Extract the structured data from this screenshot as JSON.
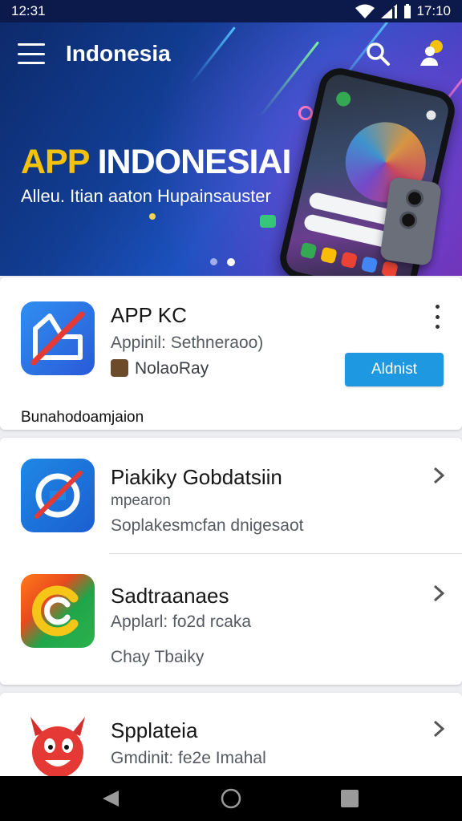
{
  "status_bar": {
    "time_left": "12:31",
    "time_right": "17:10"
  },
  "header": {
    "title": "Indonesia"
  },
  "banner": {
    "headline_a": "APP ",
    "headline_b": "INDONESIAI",
    "subtitle": "Alleu. Itian aaton Hupainsauster",
    "slides": 2,
    "active_slide": 2
  },
  "featured": {
    "name": "APP KC",
    "category": "Appinil: Sethneraoo)",
    "developer": "NolaoRay",
    "install_label": "Aldnist",
    "footer_label": "Bunahodoamjaion"
  },
  "list": [
    {
      "name": "Piakiky Gobdatsiin",
      "line1": "mpearon",
      "line2": "Soplakesmcfan dnigesaot"
    },
    {
      "name": "Sadtraanaes",
      "line1": "Applarl: fo2d rcaka",
      "line2": "Chay Tbaiky"
    },
    {
      "name": "Spplateia",
      "line1": "Gmdinit: fe2e Imahal"
    }
  ],
  "colors": {
    "status_bar": "#0b1a4a",
    "install_button": "#1e98e0",
    "headline_accent": "#f4c20d",
    "nav_bar": "#000000"
  },
  "icons": [
    "menu-icon",
    "search-icon",
    "profile-icon",
    "more-vert-icon",
    "chevron-right-icon",
    "back-icon",
    "home-icon",
    "recents-icon"
  ]
}
